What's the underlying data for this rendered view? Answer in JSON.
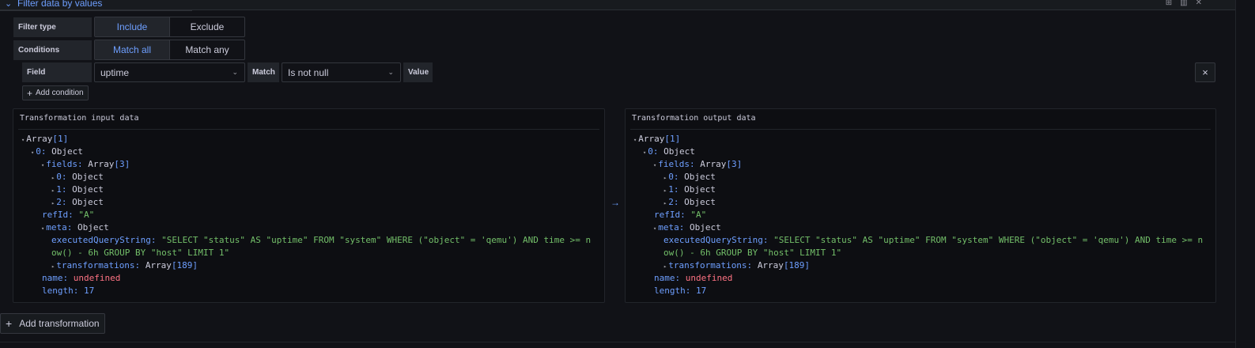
{
  "header": {
    "title": "Filter data by values"
  },
  "filter_type": {
    "label": "Filter type",
    "options": [
      "Include",
      "Exclude"
    ],
    "selected": "Include"
  },
  "conditions": {
    "label": "Conditions",
    "options": [
      "Match all",
      "Match any"
    ],
    "selected": "Match all"
  },
  "condition_row": {
    "field_label": "Field",
    "field_value": "uptime",
    "match_label": "Match",
    "match_value": "Is not null",
    "value_label": "Value",
    "remove": "×"
  },
  "add_condition": "Add condition",
  "input_panel": {
    "title": "Transformation input data"
  },
  "output_panel": {
    "title": "Transformation output data"
  },
  "tree": {
    "root": "Array",
    "root_count": "[1]",
    "item0": "0:",
    "object": "Object",
    "fields": "fields:",
    "array": "Array",
    "fields_count": "[3]",
    "f0": "0:",
    "f1": "1:",
    "f2": "2:",
    "refId_key": "refId:",
    "refId_val": "\"A\"",
    "meta": "meta:",
    "eqs_key": "executedQueryString:",
    "eqs_line1": "\"SELECT \"status\" AS \"uptime\" FROM \"system\" WHERE (\"object\" = 'qemu') AND time >= n",
    "eqs_line2": "ow() - 6h GROUP BY \"host\" LIMIT 1\"",
    "transformations": "transformations:",
    "trans_count": "[189]",
    "name_key": "name:",
    "name_val": "undefined",
    "length_key": "length:",
    "length_val": "17"
  },
  "add_transformation": "Add transformation"
}
